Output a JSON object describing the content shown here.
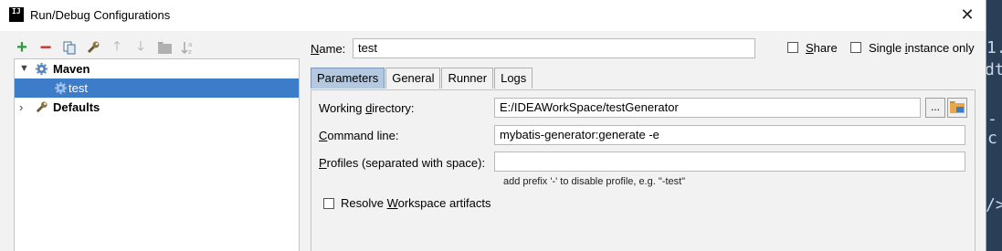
{
  "window": {
    "title": "Run/Debug Configurations",
    "app_icon_text": "IJ"
  },
  "toolbar": {
    "items": [
      {
        "icon": "add-icon",
        "glyph": "+",
        "color": "#2e9b3b"
      },
      {
        "icon": "remove-icon",
        "glyph": "−",
        "color": "#c8342b"
      },
      {
        "icon": "copy-icon",
        "glyph": "❐",
        "color": "#4a6b91"
      },
      {
        "icon": "wrench-icon",
        "glyph": "🔧",
        "color": "#7b6a3a"
      },
      {
        "icon": "move-up-icon",
        "glyph": "↑",
        "color": "#9e9e9e"
      },
      {
        "icon": "move-down-icon",
        "glyph": "↓",
        "color": "#9e9e9e"
      },
      {
        "icon": "folder-icon",
        "glyph": "■",
        "color": "#9e9e9e"
      },
      {
        "icon": "sort-icon",
        "glyph": "↓ᵃ",
        "color": "#9e9e9e"
      }
    ]
  },
  "tree": {
    "maven": {
      "label": "Maven"
    },
    "test": {
      "label": "test"
    },
    "defaults": {
      "label": "Defaults"
    }
  },
  "name_row": {
    "label_first": "N",
    "label_rest": "ame:",
    "value": "test"
  },
  "options": {
    "share": {
      "label_first": "S",
      "label_rest": "hare",
      "checked": false
    },
    "single": {
      "label_pre": "Single ",
      "label_u": "i",
      "label_rest": "nstance only",
      "checked": false
    }
  },
  "tabs": [
    {
      "label": "Parameters",
      "active": true
    },
    {
      "label": "General",
      "active": false
    },
    {
      "label": "Runner",
      "active": false
    },
    {
      "label": "Logs",
      "active": false
    }
  ],
  "params": {
    "working_dir": {
      "label_pre": "Working ",
      "label_u": "d",
      "label_rest": "irectory:",
      "value": "E:/IDEAWorkSpace/testGenerator"
    },
    "browse_button": "...",
    "command": {
      "label_u": "C",
      "label_rest": "ommand line:",
      "value": "mybatis-generator:generate -e"
    },
    "profiles": {
      "label_u": "P",
      "label_rest": "rofiles (separated with space):",
      "value": "",
      "hint": "add prefix '-' to disable profile, e.g. \"-test\""
    },
    "resolve": {
      "label_pre": "Resolve ",
      "label_u": "W",
      "label_rest": "orkspace artifacts",
      "checked": false
    }
  },
  "background_code": [
    "1.",
    "dt",
    "-c",
    "/>"
  ],
  "colors": {
    "selection": "#3d7cc9",
    "active_tab": "#b4c8e0",
    "background_ide": "#2b3e58"
  }
}
